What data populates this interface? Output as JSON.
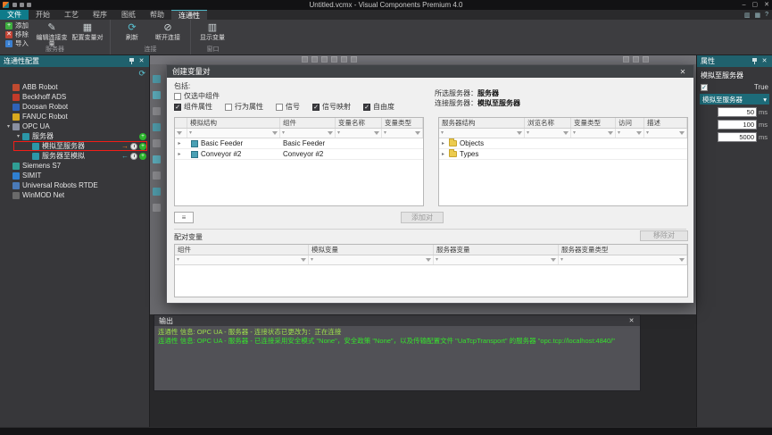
{
  "window": {
    "title": "Untitled.vcmx - Visual Components Premium 4.0"
  },
  "tabs": {
    "file": "文件",
    "items": [
      "开始",
      "工艺",
      "程序",
      "图纸",
      "帮助"
    ],
    "active": "连通性"
  },
  "ribbon": {
    "server_group": {
      "label": "服务器",
      "small": [
        "添加",
        "移除",
        "导入"
      ],
      "large": [
        "编辑连接变量",
        "配置变量对"
      ]
    },
    "connection_group": {
      "label": "连接",
      "large": [
        "刷新",
        "断开连接"
      ]
    },
    "window_group": {
      "label": "窗口",
      "large": [
        "显示变量"
      ]
    }
  },
  "left_panel": {
    "title": "连通性配置",
    "tree": [
      {
        "label": "ABB Robot"
      },
      {
        "label": "Beckhoff ADS"
      },
      {
        "label": "Doosan Robot"
      },
      {
        "label": "FANUC Robot"
      },
      {
        "label": "OPC UA"
      },
      {
        "label": "服务器"
      },
      {
        "label": "模拟至服务器"
      },
      {
        "label": "服务器至模拟"
      },
      {
        "label": "Siemens S7"
      },
      {
        "label": "SIMIT"
      },
      {
        "label": "Universal Robots RTDE"
      },
      {
        "label": "WinMOD Net"
      }
    ]
  },
  "dialog": {
    "title": "创建变量对",
    "include_label": "包括:",
    "checkboxes": [
      {
        "label": "仅选中组件",
        "checked": false
      },
      {
        "label": "组件属性",
        "checked": true
      },
      {
        "label": "行为属性",
        "checked": false
      },
      {
        "label": "信号",
        "checked": false
      },
      {
        "label": "信号映射",
        "checked": true
      },
      {
        "label": "自由度",
        "checked": true
      }
    ],
    "selected_server_label": "所选服务器：",
    "selected_server_value": "服务器",
    "connected_server_label": "连接服务器：",
    "connected_server_value": "模拟至服务器",
    "sim_table": {
      "headers": [
        "模拟结构",
        "组件",
        "变量名称",
        "变量类型"
      ],
      "rows": [
        {
          "name": "Basic Feeder",
          "component": "Basic Feeder"
        },
        {
          "name": "Conveyor #2",
          "component": "Conveyor #2"
        }
      ]
    },
    "server_table": {
      "headers": [
        "服务器结构",
        "浏览名称",
        "变量类型",
        "访问",
        "描述"
      ],
      "rows": [
        {
          "name": "Objects"
        },
        {
          "name": "Types"
        }
      ]
    },
    "add_pair_button": "添加对",
    "paired_label": "配对变量",
    "remove_pair_button": "移除对",
    "paired_table": {
      "headers": [
        "组件",
        "模拟变量",
        "服务器变量",
        "服务器变量类型"
      ]
    }
  },
  "properties_panel": {
    "title": "属性",
    "name": "模拟至服务器",
    "bool_value": "True",
    "dropdown_value": "模拟至服务器",
    "fields": [
      {
        "value": "50",
        "unit": "ms"
      },
      {
        "value": "100",
        "unit": "ms"
      },
      {
        "value": "5000",
        "unit": "ms"
      }
    ]
  },
  "output_panel": {
    "title": "输出",
    "lines": [
      "连通性 信息: OPC UA - 服务器 - 连接状态已更改为：正在连接",
      "连通性 信息: OPC UA - 服务器 - 已连接采用安全模式 \"None\"，安全政策 \"None\"，以及传输配置文件 \"UaTcpTransport\" 的服务器 \"opc.tcp://localhost:4840/\""
    ]
  },
  "glyphs": {
    "close": "✕",
    "min": "–",
    "max": "▢",
    "dropdown": "▾",
    "expander_open": "▾",
    "expander_closed": "▸",
    "refresh": "⟳",
    "check": "✓",
    "plus": "+",
    "cross": "✕",
    "arrow_down": "↓",
    "arrow_right": "→",
    "arrow_left": "←",
    "edit": "✎",
    "grid": "▦",
    "disconnect": "⊘",
    "panel": "▥",
    "menu": "≡",
    "help": "?"
  }
}
